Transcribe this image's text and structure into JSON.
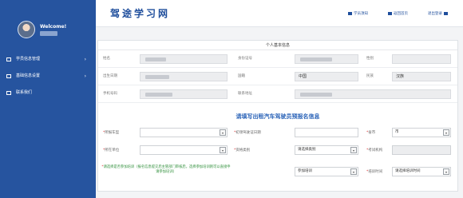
{
  "app": {
    "title": "驾途学习网"
  },
  "header": {
    "links": [
      {
        "label": "学员须知",
        "icon": "bookmark-icon"
      },
      {
        "label": "返回首页",
        "icon": "home-icon"
      },
      {
        "label": "退出登录",
        "icon": "logout-icon"
      }
    ]
  },
  "sidebar": {
    "welcome": "Welcome!",
    "user_name": "",
    "items": [
      {
        "label": "学员信息管理",
        "icon": "list-icon",
        "has_children": true
      },
      {
        "label": "基础信息设置",
        "icon": "settings-icon",
        "has_children": true
      },
      {
        "label": "联系我们",
        "icon": "contact-icon",
        "has_children": false
      }
    ],
    "chevron": "›"
  },
  "personal_info": {
    "title": "个人基本信息",
    "labels": {
      "name": "姓名",
      "id_number": "身份证号",
      "gender": "性别",
      "birth_date": "出生日期",
      "nationality": "国籍",
      "ethnicity": "民族",
      "phone": "手机号码",
      "address": "联系地址"
    },
    "values": {
      "name": "",
      "id_number": "",
      "gender": "",
      "birth_date": "",
      "nationality": "中国",
      "ethnicity": "汉族",
      "phone": "",
      "address": ""
    }
  },
  "form": {
    "title": "请填写出租汽车驾驶员预报名信息",
    "required_mark": "*",
    "labels": {
      "vehicle_type": "所报车型",
      "license_date": "初领驾驶证日期",
      "province": "省市",
      "employer": "所在单位",
      "exam_category": "资格类别",
      "exam_location": "考试机构",
      "training_choice": "请选择是否参加培训（报名信息提交后主管部门审核后，选择参加培训则可以直接申请参加培训）",
      "training_time": "培训时间"
    },
    "values": {
      "vehicle_type": "",
      "license_date": "",
      "province": "市",
      "employer": "",
      "exam_category": "请选择类别",
      "exam_location": "",
      "training_choice": "参加培训",
      "training_time": "请选择培训时间"
    },
    "dropdown_arrow": "▾"
  },
  "colors": {
    "sidebar_bg": "#26549f",
    "brand": "#1f4e9c",
    "form_title": "#2a63b8",
    "note_green": "#2f8f3a",
    "required_red": "#d33333"
  }
}
